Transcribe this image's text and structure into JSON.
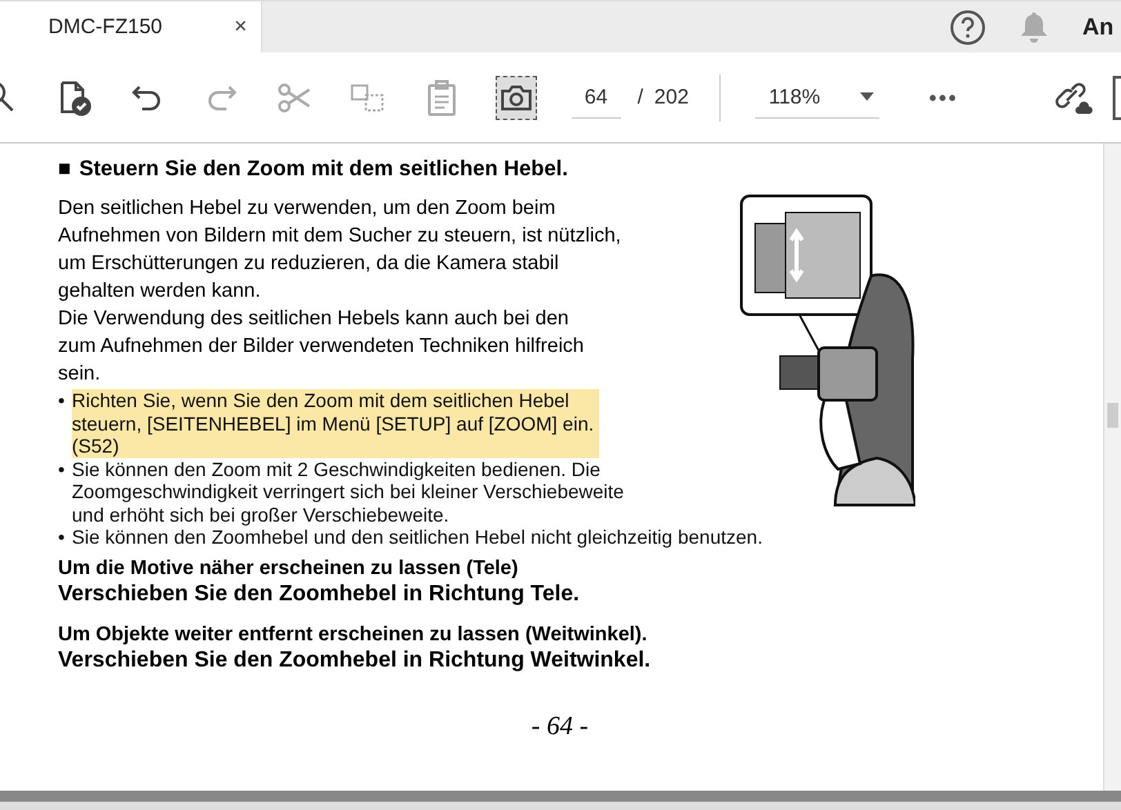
{
  "tab": {
    "title": "DMC-FZ150",
    "close": "×"
  },
  "header": {
    "user_text": "An"
  },
  "toolbar": {
    "tools": [
      {
        "kind": "search",
        "selected": false,
        "disabled": false
      },
      {
        "kind": "spellcheck",
        "selected": false,
        "disabled": false
      },
      {
        "kind": "undo",
        "selected": false,
        "disabled": false
      },
      {
        "kind": "redo",
        "selected": false,
        "disabled": true
      },
      {
        "kind": "cut",
        "selected": false,
        "disabled": true
      },
      {
        "kind": "copy",
        "selected": false,
        "disabled": true
      },
      {
        "kind": "paste",
        "selected": false,
        "disabled": true
      },
      {
        "kind": "snapshot",
        "selected": true,
        "disabled": false
      }
    ],
    "page_input": "64",
    "page_separator": "/",
    "page_total": "202",
    "zoom": "118%"
  },
  "document": {
    "heading_marker": "■",
    "heading": "Steuern Sie den Zoom mit dem seitlichen Hebel.",
    "paragraph": "Den seitlichen Hebel zu verwenden, um den Zoom beim\nAufnehmen von Bildern mit dem Sucher zu steuern, ist nützlich,\num Erschütterungen zu reduzieren, da die Kamera stabil\ngehalten werden kann.\nDie Verwendung des seitlichen Hebels kann auch bei den\nzum Aufnehmen der Bilder verwendeten Techniken hilfreich\nsein.",
    "bullets": [
      {
        "bullet": "•",
        "text": "Richten Sie, wenn Sie den Zoom mit dem seitlichen Hebel\nsteuern, [SEITENHEBEL] im Menü [SETUP] auf [ZOOM] ein.\n(S52)",
        "highlighted": true
      },
      {
        "bullet": "•",
        "text": "Sie können den Zoom mit 2 Geschwindigkeiten bedienen. Die\nZoomgeschwindigkeit verringert sich bei kleiner Verschiebeweite\nund erhöht sich bei großer Verschiebeweite.",
        "highlighted": false
      },
      {
        "bullet": "•",
        "text": "Sie können den Zoomhebel und den seitlichen Hebel nicht gleichzeitig benutzen.",
        "highlighted": false
      }
    ],
    "instructions": [
      {
        "condition": "Um die Motive näher erscheinen zu lassen (Tele)",
        "action": "Verschieben Sie den Zoomhebel in Richtung Tele."
      },
      {
        "condition": "Um Objekte weiter entfernt erscheinen zu lassen (Weitwinkel).",
        "action": "Verschieben Sie den Zoomhebel in Richtung Weitwinkel."
      }
    ],
    "page_number": "- 64 -"
  }
}
